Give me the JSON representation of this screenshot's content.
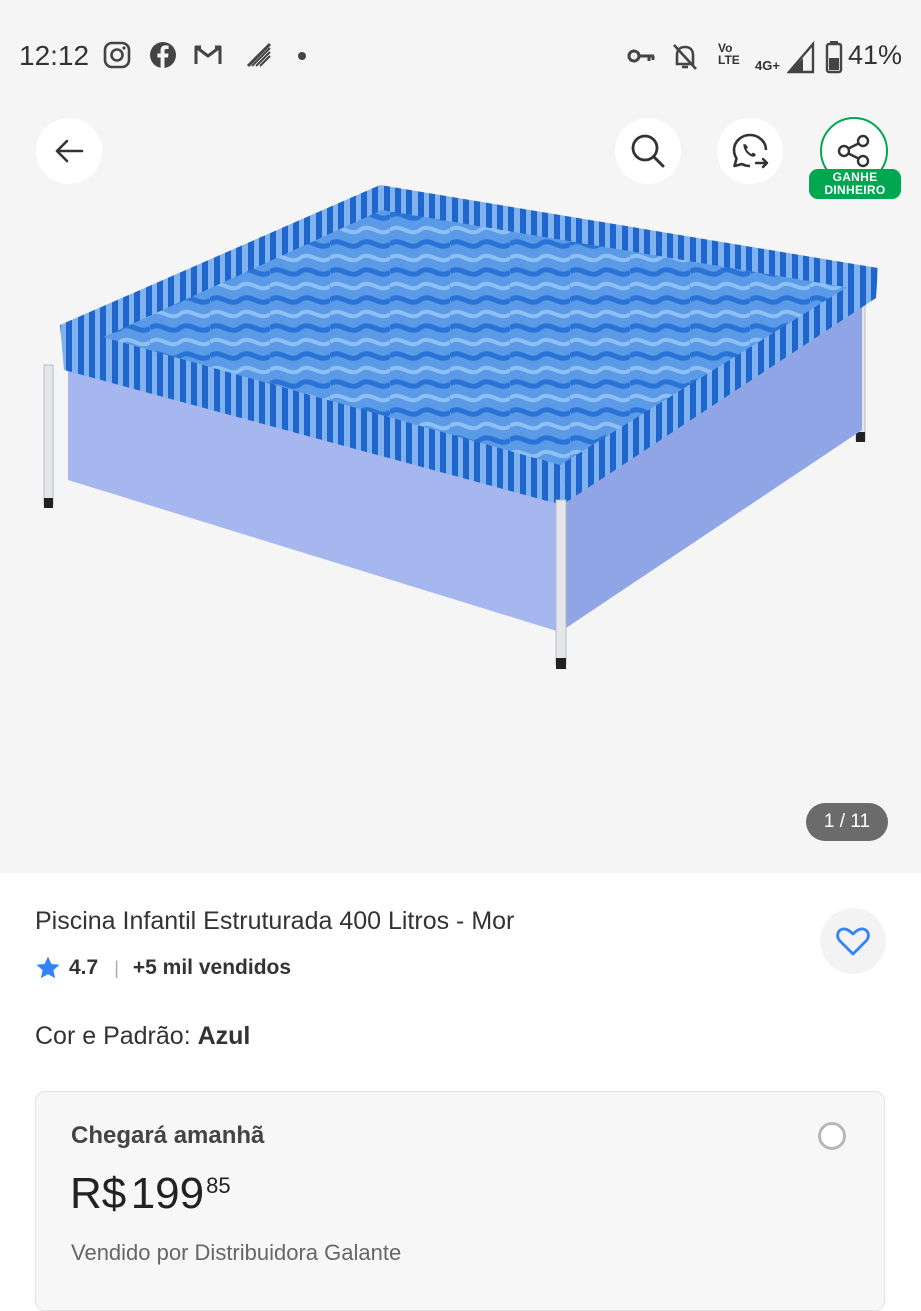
{
  "status_bar": {
    "time": "12:12",
    "network_line1": "Vo",
    "network_line2": "LTE",
    "network_type": "4G+",
    "battery": "41%"
  },
  "header": {
    "share_badge_line1": "GANHE",
    "share_badge_line2": "DINHEIRO"
  },
  "gallery": {
    "counter": "1 / 11"
  },
  "product": {
    "title": "Piscina Infantil Estruturada 400 Litros - Mor",
    "rating": "4.7",
    "sold": "+5 mil vendidos",
    "variant_label": "Cor e Padrão:",
    "variant_value": "Azul"
  },
  "shipping": {
    "title": "Chegará amanhã",
    "price_currency": "R$",
    "price_integer": "199",
    "price_cents": "85",
    "seller": "Vendido por Distribuidora Galante"
  },
  "colors": {
    "accent_green": "#00a650",
    "favorite_blue": "#3483fa",
    "star_blue": "#3483fa"
  },
  "icons": [
    "back-arrow-icon",
    "search-icon",
    "whatsapp-icon",
    "share-icon",
    "heart-icon",
    "star-icon"
  ]
}
